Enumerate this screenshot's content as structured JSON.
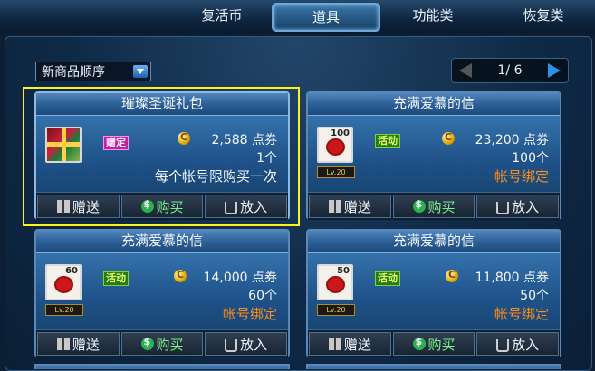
{
  "tabs": [
    {
      "label": "复活币"
    },
    {
      "label": "道具"
    },
    {
      "label": "功能类"
    },
    {
      "label": "恢复类"
    }
  ],
  "sort": {
    "label": "新商品顺序"
  },
  "pager": {
    "text": "1/ 6"
  },
  "cards": [
    {
      "title": "璀璨圣诞礼包",
      "icon": "gift-box-icon",
      "tag": "赠定",
      "price": "2,588 点券",
      "qty": "1个",
      "note": "每个帐号限购买一次",
      "level": "",
      "icon_num": "",
      "buttons": {
        "gift": "赠送",
        "buy": "购买",
        "cart": "放入"
      }
    },
    {
      "title": "充满爱慕的信",
      "icon": "letter-icon",
      "tag": "活动",
      "price": "23,200 点券",
      "qty": "100个",
      "note": "帐号绑定",
      "level": "Lv.20",
      "icon_num": "100",
      "buttons": {
        "gift": "赠送",
        "buy": "购买",
        "cart": "放入"
      }
    },
    {
      "title": "充满爱慕的信",
      "icon": "letter-icon",
      "tag": "活动",
      "price": "14,000 点券",
      "qty": "60个",
      "note": "帐号绑定",
      "level": "Lv.20",
      "icon_num": "60",
      "buttons": {
        "gift": "赠送",
        "buy": "购买",
        "cart": "放入"
      }
    },
    {
      "title": "充满爱慕的信",
      "icon": "letter-icon",
      "tag": "活动",
      "price": "11,800 点券",
      "qty": "50个",
      "note": "帐号绑定",
      "level": "Lv.20",
      "icon_num": "50",
      "buttons": {
        "gift": "赠送",
        "buy": "购买",
        "cart": "放入"
      }
    }
  ],
  "colors": {
    "highlight": "#fff21a",
    "binding_note": "#ff8e1a",
    "active_tag": "#267a17"
  }
}
